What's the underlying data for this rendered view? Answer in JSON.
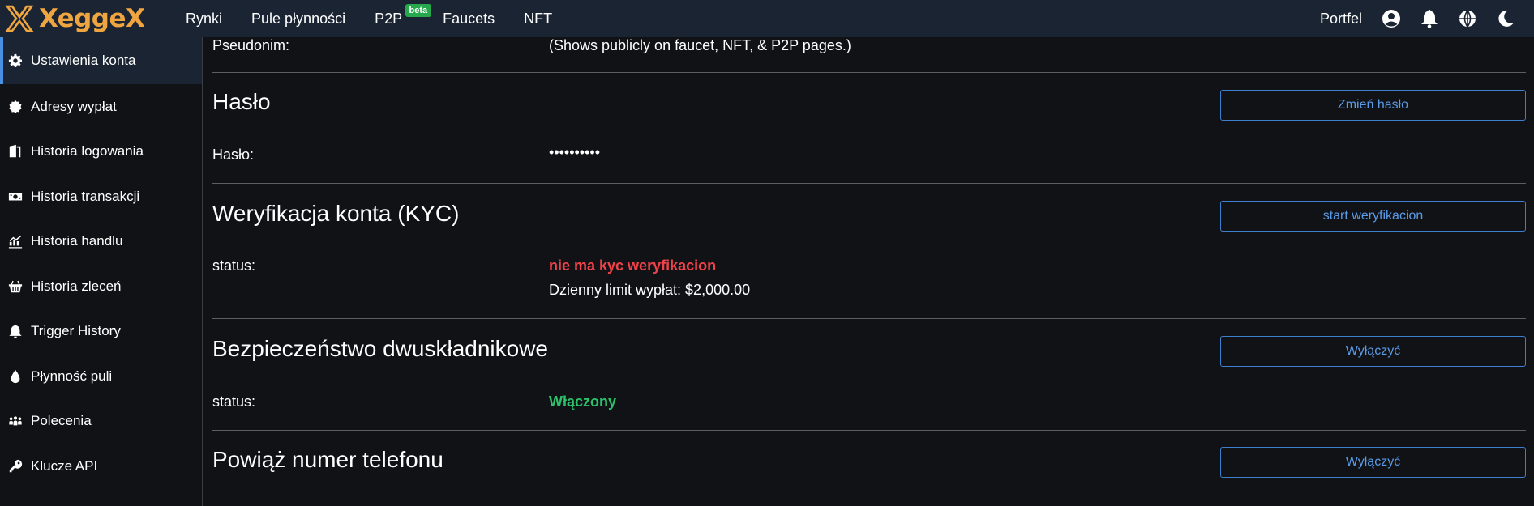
{
  "brand": {
    "name": "XeggeX"
  },
  "nav": {
    "items": [
      {
        "label": "Rynki"
      },
      {
        "label": "Pule płynności"
      },
      {
        "label": "P2P",
        "badge": "beta"
      },
      {
        "label": "Faucets"
      },
      {
        "label": "NFT"
      }
    ],
    "wallet_label": "Portfel",
    "icons": [
      "user-circle-icon",
      "bell-icon",
      "globe-icon",
      "moon-icon"
    ]
  },
  "sidebar": {
    "items": [
      {
        "label": "Ustawienia konta",
        "icon": "gear-icon",
        "active": true
      },
      {
        "label": "Adresy wypłat",
        "icon": "badge-icon"
      },
      {
        "label": "Historia logowania",
        "icon": "door-icon"
      },
      {
        "label": "Historia transakcji",
        "icon": "money-icon"
      },
      {
        "label": "Historia handlu",
        "icon": "chart-icon"
      },
      {
        "label": "Historia zleceń",
        "icon": "basket-icon"
      },
      {
        "label": "Trigger History",
        "icon": "bell-icon"
      },
      {
        "label": "Płynność puli",
        "icon": "drop-icon"
      },
      {
        "label": "Polecenia",
        "icon": "people-icon"
      },
      {
        "label": "Klucze API",
        "icon": "key-icon"
      }
    ]
  },
  "main": {
    "nickname": {
      "label": "Pseudonim:",
      "value": "(Shows publicly on faucet, NFT, & P2P pages.)"
    },
    "password": {
      "title": "Hasło",
      "button": "Zmień hasło",
      "label": "Hasło:",
      "value": "••••••••••"
    },
    "kyc": {
      "title": "Weryfikacja konta (KYC)",
      "button": "start weryfikacion",
      "label": "status:",
      "status": "nie ma kyc weryfikacion",
      "limit": "Dzienny limit wypłat: $2,000.00"
    },
    "twofa": {
      "title": "Bezpieczeństwo dwuskładnikowe",
      "button": "Wyłączyć",
      "label": "status:",
      "status": "Włączony"
    },
    "phone": {
      "title": "Powiąż numer telefonu",
      "button": "Wyłączyć"
    }
  },
  "colors": {
    "accent": "#f0a640",
    "link_blue": "#5a9be8",
    "status_red": "#f0424a",
    "status_green": "#2bc26b",
    "topbar_bg": "#1a2433"
  }
}
